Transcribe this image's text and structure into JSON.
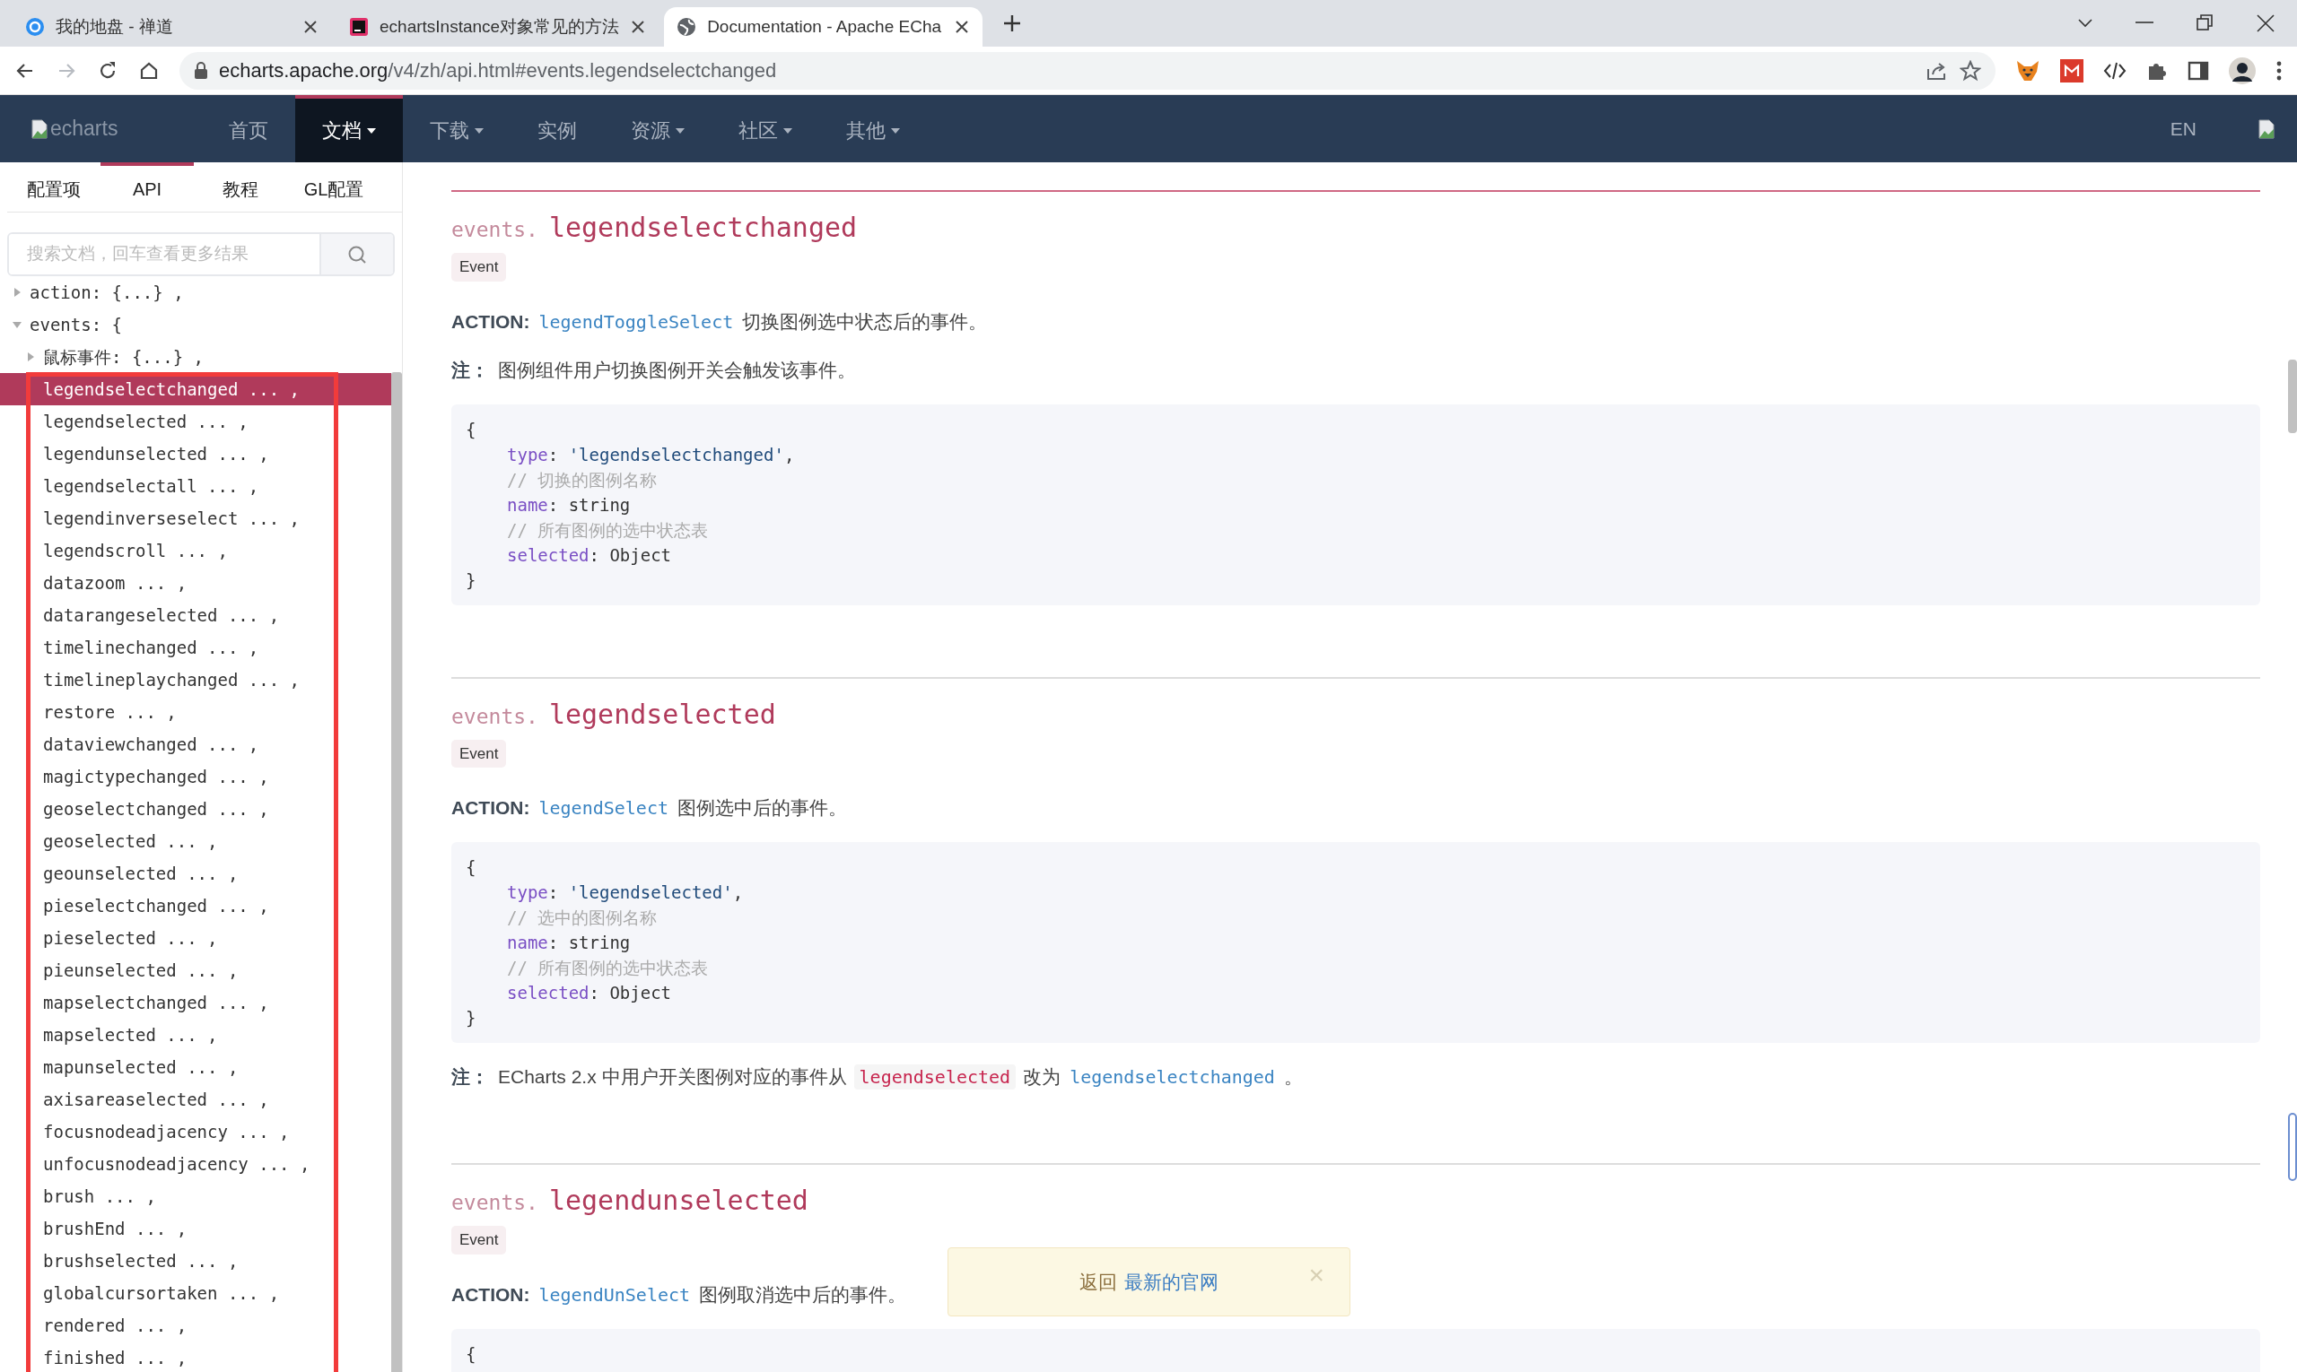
{
  "browser": {
    "tabs": [
      {
        "title": "我的地盘 - 禅道",
        "selected": false
      },
      {
        "title": "echartsInstance对象常见的方法",
        "selected": false
      },
      {
        "title": "Documentation - Apache ECha",
        "selected": true
      }
    ],
    "nav_buttons": [
      {
        "kind": "back",
        "disabled": false
      },
      {
        "kind": "forward",
        "disabled": true
      },
      {
        "kind": "reload",
        "disabled": false
      },
      {
        "kind": "home",
        "disabled": false
      }
    ],
    "address": {
      "host": "echarts.apache.org",
      "path": "/v4/zh/api.html#events.legendselectchanged"
    }
  },
  "navbar": {
    "logo_alt": "echarts",
    "items": [
      {
        "label": "首页",
        "dropdown": false,
        "selected": false
      },
      {
        "label": "文档",
        "dropdown": true,
        "selected": true
      },
      {
        "label": "下载",
        "dropdown": true,
        "selected": false
      },
      {
        "label": "实例",
        "dropdown": false,
        "selected": false
      },
      {
        "label": "资源",
        "dropdown": true,
        "selected": false
      },
      {
        "label": "社区",
        "dropdown": true,
        "selected": false
      },
      {
        "label": "其他",
        "dropdown": true,
        "selected": false
      }
    ],
    "language": "EN"
  },
  "sidebar": {
    "tabs": [
      {
        "label": "配置项",
        "selected": false
      },
      {
        "label": "API",
        "selected": true
      },
      {
        "label": "教程",
        "selected": false
      },
      {
        "label": "GL配置",
        "selected": false
      }
    ],
    "search": {
      "placeholder": "搜索文档，回车查看更多结果"
    },
    "tree": [
      {
        "label": "action: {...} ,",
        "expanded": false,
        "selected": false
      },
      {
        "label": "events: {",
        "expanded": true,
        "selected": false,
        "children": [
          {
            "label": "鼠标事件: {...} ,",
            "expanded": false,
            "selected": false
          },
          {
            "label": "legendselectchanged ... ,",
            "selected": true
          },
          {
            "label": "legendselected ... ,",
            "selected": false
          },
          {
            "label": "legendunselected ... ,",
            "selected": false
          },
          {
            "label": "legendselectall ... ,",
            "selected": false
          },
          {
            "label": "legendinverseselect ... ,",
            "selected": false
          },
          {
            "label": "legendscroll ... ,",
            "selected": false
          },
          {
            "label": "datazoom ... ,",
            "selected": false
          },
          {
            "label": "datarangeselected ... ,",
            "selected": false
          },
          {
            "label": "timelinechanged ... ,",
            "selected": false
          },
          {
            "label": "timelineplaychanged ... ,",
            "selected": false
          },
          {
            "label": "restore ... ,",
            "selected": false
          },
          {
            "label": "dataviewchanged ... ,",
            "selected": false
          },
          {
            "label": "magictypechanged ... ,",
            "selected": false
          },
          {
            "label": "geoselectchanged ... ,",
            "selected": false
          },
          {
            "label": "geoselected ... ,",
            "selected": false
          },
          {
            "label": "geounselected ... ,",
            "selected": false
          },
          {
            "label": "pieselectchanged ... ,",
            "selected": false
          },
          {
            "label": "pieselected ... ,",
            "selected": false
          },
          {
            "label": "pieunselected ... ,",
            "selected": false
          },
          {
            "label": "mapselectchanged ... ,",
            "selected": false
          },
          {
            "label": "mapselected ... ,",
            "selected": false
          },
          {
            "label": "mapunselected ... ,",
            "selected": false
          },
          {
            "label": "axisareaselected ... ,",
            "selected": false
          },
          {
            "label": "focusnodeadjacency ... ,",
            "selected": false
          },
          {
            "label": "unfocusnodeadjacency ... ,",
            "selected": false
          },
          {
            "label": "brush ... ,",
            "selected": false
          },
          {
            "label": "brushEnd ... ,",
            "selected": false
          },
          {
            "label": "brushselected ... ,",
            "selected": false
          },
          {
            "label": "globalcursortaken ... ,",
            "selected": false
          },
          {
            "label": "rendered ... ,",
            "selected": false
          },
          {
            "label": "finished ... ,",
            "selected": false
          }
        ]
      }
    ],
    "highlight_frame": true
  },
  "sections": [
    {
      "selected": true,
      "prefix": "events.",
      "name": "legendselectchanged",
      "badge": "Event",
      "action": {
        "label": "ACTION:",
        "link": "legendToggleSelect",
        "description": "切换图例选中状态后的事件。"
      },
      "notes_before_code": [
        {
          "label": "注：",
          "parts": [
            {
              "kind": "text",
              "text": "图例组件用户切换图例开关会触发该事件。"
            }
          ]
        }
      ],
      "code": [
        {
          "kind": "open",
          "text": "{"
        },
        {
          "kind": "field",
          "key": "type",
          "sep": ":",
          "value": "'legendselectchanged'",
          "literal": true,
          "suffix": ","
        },
        {
          "kind": "comment",
          "text": "// 切换的图例名称"
        },
        {
          "kind": "field",
          "key": "name",
          "sep": ":",
          "value": "string",
          "literal": false
        },
        {
          "kind": "comment",
          "text": "// 所有图例的选中状态表"
        },
        {
          "kind": "field",
          "key": "selected",
          "sep": ":",
          "value": "Object",
          "literal": false
        },
        {
          "kind": "close",
          "text": "}"
        }
      ]
    },
    {
      "selected": false,
      "prefix": "events.",
      "name": "legendselected",
      "badge": "Event",
      "action": {
        "label": "ACTION:",
        "link": "legendSelect",
        "description": "图例选中后的事件。"
      },
      "code": [
        {
          "kind": "open",
          "text": "{"
        },
        {
          "kind": "field",
          "key": "type",
          "sep": ":",
          "value": "'legendselected'",
          "literal": true,
          "suffix": ","
        },
        {
          "kind": "comment",
          "text": "// 选中的图例名称"
        },
        {
          "kind": "field",
          "key": "name",
          "sep": ":",
          "value": "string",
          "literal": false
        },
        {
          "kind": "comment",
          "text": "// 所有图例的选中状态表"
        },
        {
          "kind": "field",
          "key": "selected",
          "sep": ":",
          "value": "Object",
          "literal": false
        },
        {
          "kind": "close",
          "text": "}"
        }
      ],
      "notes_after_code": [
        {
          "label": "注：",
          "parts": [
            {
              "kind": "text",
              "text": "ECharts 2.x 中用户开关图例对应的事件从"
            },
            {
              "kind": "code",
              "text": "legendselected"
            },
            {
              "kind": "text",
              "text": "改为"
            },
            {
              "kind": "link",
              "text": "legendselectchanged"
            },
            {
              "kind": "text",
              "text": "。"
            }
          ]
        }
      ]
    },
    {
      "selected": false,
      "prefix": "events.",
      "name": "legendunselected",
      "badge": "Event",
      "action": {
        "label": "ACTION:",
        "link": "legendUnSelect",
        "description": "图例取消选中后的事件。"
      },
      "code": [
        {
          "kind": "open",
          "text": "{"
        }
      ]
    }
  ],
  "toast": {
    "text": "返回",
    "link": "最新的官网",
    "close": "×"
  }
}
